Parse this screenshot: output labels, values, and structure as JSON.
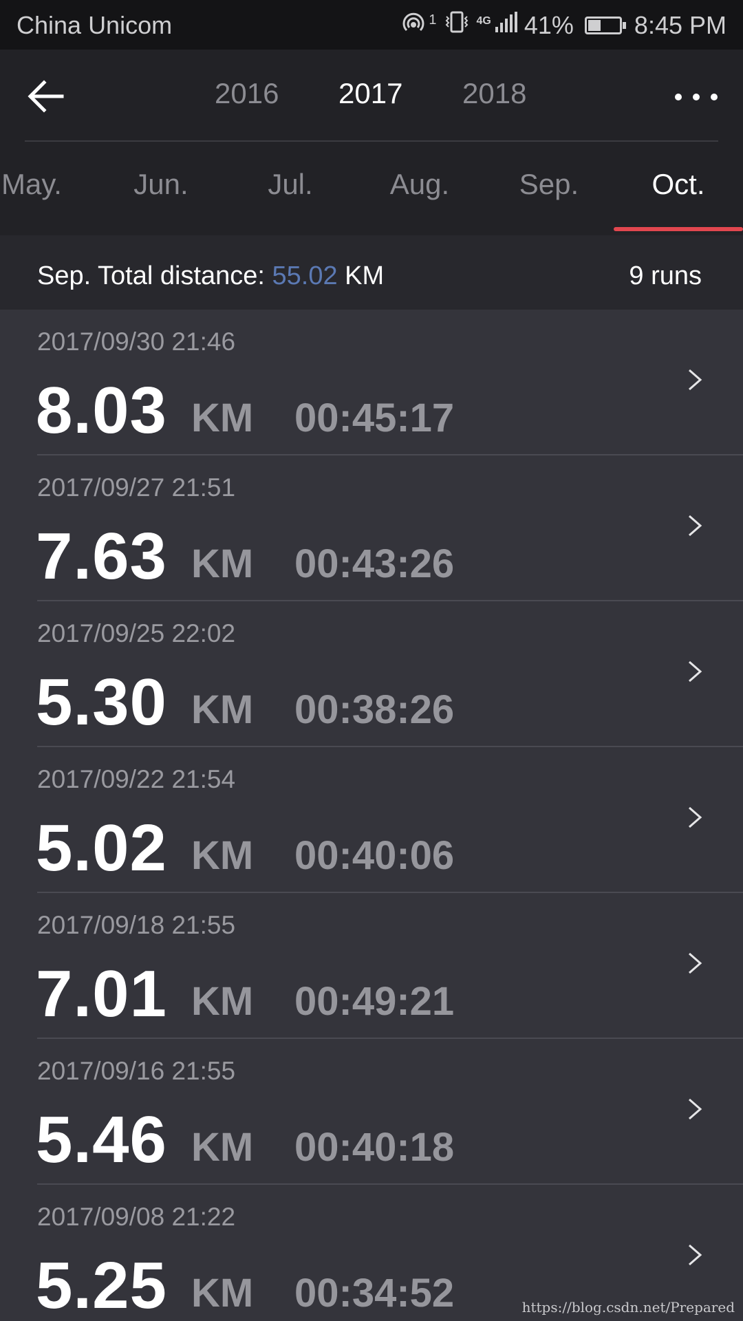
{
  "status_bar": {
    "carrier": "China Unicom",
    "hotspot_badge": "1",
    "network": "4G",
    "battery_percent": "41%",
    "battery_level": 0.41,
    "time": "8:45 PM"
  },
  "header": {
    "years": [
      "2016",
      "2017",
      "2018"
    ],
    "selected_year": "2017",
    "months": [
      "May.",
      "Jun.",
      "Jul.",
      "Aug.",
      "Sep.",
      "Oct."
    ],
    "selected_month": "Oct."
  },
  "summary": {
    "label": "Sep. Total distance: ",
    "distance": "55.02",
    "unit": " KM",
    "runs": "9 runs"
  },
  "runs": [
    {
      "date": "2017/09/30 21:46",
      "distance": "8.03",
      "unit": "KM",
      "duration": "00:45:17"
    },
    {
      "date": "2017/09/27 21:51",
      "distance": "7.63",
      "unit": "KM",
      "duration": "00:43:26"
    },
    {
      "date": "2017/09/25 22:02",
      "distance": "5.30",
      "unit": "KM",
      "duration": "00:38:26"
    },
    {
      "date": "2017/09/22 21:54",
      "distance": "5.02",
      "unit": "KM",
      "duration": "00:40:06"
    },
    {
      "date": "2017/09/18 21:55",
      "distance": "7.01",
      "unit": "KM",
      "duration": "00:49:21"
    },
    {
      "date": "2017/09/16 21:55",
      "distance": "5.46",
      "unit": "KM",
      "duration": "00:40:18"
    },
    {
      "date": "2017/09/08 21:22",
      "distance": "5.25",
      "unit": "KM",
      "duration": "00:34:52"
    }
  ],
  "watermark": "https://blog.csdn.net/Prepared",
  "colors": {
    "accent": "#e2474f",
    "distance_highlight": "#5b79b3",
    "background": "#34343b"
  }
}
